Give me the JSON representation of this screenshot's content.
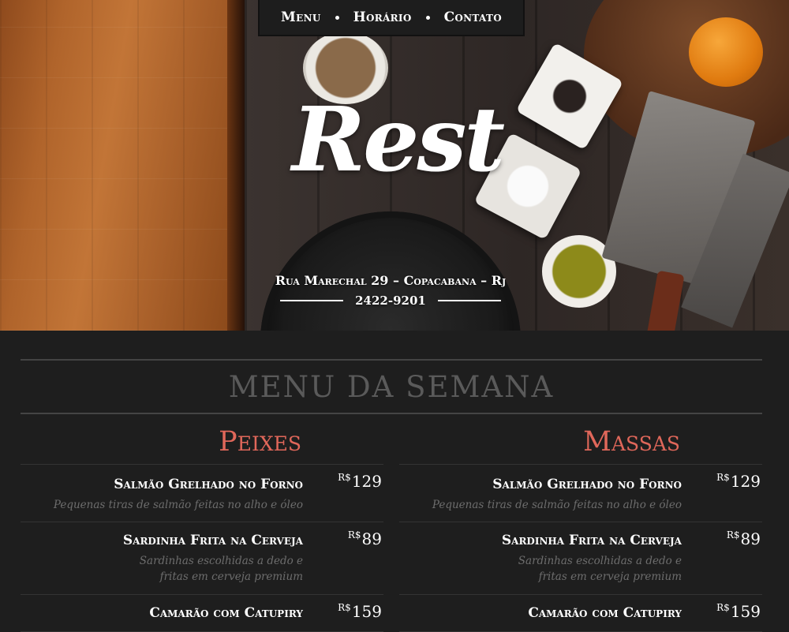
{
  "nav": {
    "items": [
      "Menu",
      "Horário",
      "Contato"
    ]
  },
  "hero": {
    "logo": "Rest",
    "address": "Rua Marechal 29 – Copacabana – Rj",
    "phone": "2422-9201"
  },
  "menu": {
    "title": "MENU DA SEMANA",
    "sections": [
      {
        "title": "Peixes",
        "items": [
          {
            "name": "Salmão Grelhado no Forno",
            "description": "Pequenas tiras de salmão feitas no alho e óleo",
            "currency": "R$",
            "price": "129"
          },
          {
            "name": "Sardinha Frita na Cerveja",
            "description": "Sardinhas escolhidas a dedo e fritas em cerveja premium",
            "currency": "R$",
            "price": "89"
          },
          {
            "name": "Camarão com Catupiry",
            "description": "",
            "currency": "R$",
            "price": "159"
          }
        ]
      },
      {
        "title": "Massas",
        "items": [
          {
            "name": "Salmão Grelhado no Forno",
            "description": "Pequenas tiras de salmão feitas no alho e óleo",
            "currency": "R$",
            "price": "129"
          },
          {
            "name": "Sardinha Frita na Cerveja",
            "description": "Sardinhas escolhidas a dedo e fritas em cerveja premium",
            "currency": "R$",
            "price": "89"
          },
          {
            "name": "Camarão com Catupiry",
            "description": "",
            "currency": "R$",
            "price": "159"
          }
        ]
      }
    ]
  },
  "colors": {
    "accent": "#e0675a",
    "background": "#1e1e1e",
    "muted_text": "#6d6d6d"
  }
}
